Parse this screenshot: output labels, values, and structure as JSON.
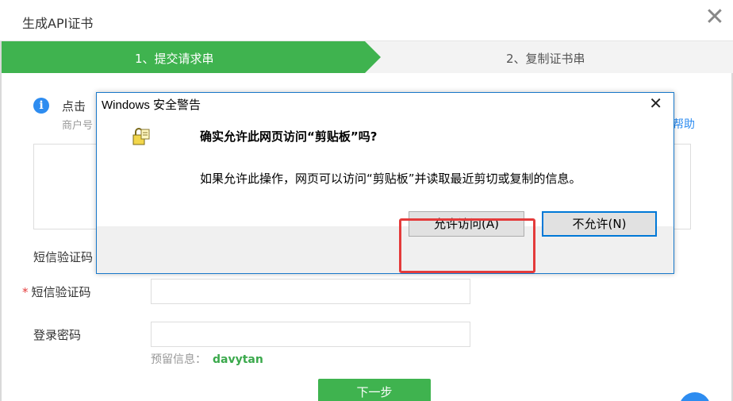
{
  "header": {
    "title": "生成API证书"
  },
  "steps": [
    {
      "label": "1、提交请求串",
      "active": true
    },
    {
      "label": "2、复制证书串",
      "active": false
    }
  ],
  "info": {
    "text": "点击",
    "sub": "商户号",
    "help": "帮助"
  },
  "form": {
    "sms_label_partial": "短信验证码",
    "sms_label": "短信验证码",
    "password_label": "登录密码",
    "reserved_label": "预留信息：",
    "reserved_value": "davytan",
    "next_button": "下一步"
  },
  "dialog": {
    "title": "Windows 安全警告",
    "question": "确实允许此网页访问“剪贴板”吗?",
    "description": "如果允许此操作，网页可以访问“剪贴板”并读取最近剪切或复制的信息。",
    "allow_button": "允许访问(A)",
    "deny_button": "不允许(N)"
  },
  "colors": {
    "accent_green": "#3fb34f",
    "link_blue": "#2d8cf0",
    "highlight_red": "#e43b3b",
    "win_border": "#1979ca"
  }
}
